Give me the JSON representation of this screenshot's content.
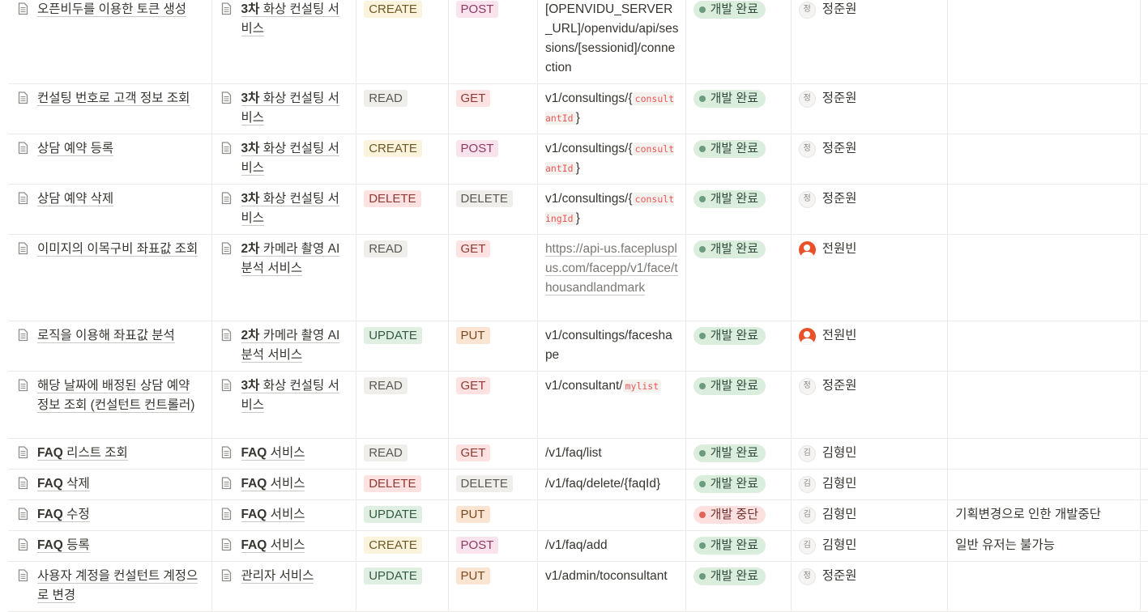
{
  "colors": {
    "crud": {
      "CREATE": {
        "bg": "#fbf3db",
        "fg": "#6b5a28"
      },
      "READ": {
        "bg": "#efeeeb",
        "fg": "#5a5854"
      },
      "DELETE": {
        "bg": "#fde2e1",
        "fg": "#8d3a35"
      },
      "UPDATE": {
        "bg": "#dff0e3",
        "fg": "#365a3f"
      }
    },
    "method": {
      "POST": {
        "bg": "#f9e4ee",
        "fg": "#8c3a63"
      },
      "GET": {
        "bg": "#fde2e1",
        "fg": "#8d3a35"
      },
      "DELETE": {
        "bg": "#efeeeb",
        "fg": "#5a5854"
      },
      "PUT": {
        "bg": "#fbe4d2",
        "fg": "#7a4a22"
      }
    },
    "status": {
      "done": {
        "bg": "#dbeddd",
        "fg": "#2f4b35",
        "dot": "#6c9b7d"
      },
      "stopped": {
        "bg": "#fde1e0",
        "fg": "#6e2d2a",
        "dot": "#e16259"
      }
    }
  },
  "rows": [
    {
      "name": "오픈비두를 이용한 토큰 생성",
      "service": "3차 화상 컨설팅 서비스",
      "service_prefix": "3차",
      "service_rest": " 화상 컨설팅 서비스",
      "crud": "CREATE",
      "method": "POST",
      "url_parts": [
        {
          "t": "[OPENVIDU_SERVER_URL]/openvidu/api/sessions/[sessionid]/connection"
        }
      ],
      "status": "개발 완료",
      "status_kind": "done",
      "person": "정준원",
      "avatar": "정",
      "avatar_kind": "initial",
      "note": ""
    },
    {
      "name": "컨설팅 번호로 고객 정보 조회",
      "service": "3차 화상 컨설팅 서비스",
      "service_prefix": "3차",
      "service_rest": " 화상 컨설팅 서비스",
      "crud": "READ",
      "method": "GET",
      "url_parts": [
        {
          "t": "v1/consultings/{"
        },
        {
          "c": "consultantId"
        },
        {
          "t": "}"
        }
      ],
      "status": "개발 완료",
      "status_kind": "done",
      "person": "정준원",
      "avatar": "정",
      "avatar_kind": "initial",
      "note": ""
    },
    {
      "name": "상담 예약 등록",
      "service": "3차 화상 컨설팅 서비스",
      "service_prefix": "3차",
      "service_rest": " 화상 컨설팅 서비스",
      "crud": "CREATE",
      "method": "POST",
      "url_parts": [
        {
          "t": "v1/consultings/{"
        },
        {
          "c": "consultantId"
        },
        {
          "t": "}"
        }
      ],
      "status": "개발 완료",
      "status_kind": "done",
      "person": "정준원",
      "avatar": "정",
      "avatar_kind": "initial",
      "note": ""
    },
    {
      "name": "상담 예약 삭제",
      "service": "3차 화상 컨설팅 서비스",
      "service_prefix": "3차",
      "service_rest": " 화상 컨설팅 서비스",
      "crud": "DELETE",
      "method": "DELETE",
      "url_parts": [
        {
          "t": "v1/consultings/{"
        },
        {
          "c": "consultingId"
        },
        {
          "t": "}"
        }
      ],
      "status": "개발 완료",
      "status_kind": "done",
      "person": "정준원",
      "avatar": "정",
      "avatar_kind": "initial",
      "note": ""
    },
    {
      "name": "이미지의  이목구비 좌표값 조회",
      "service": "2차 카메라 촬영 AI 분석 서비스",
      "service_prefix": "2차",
      "service_rest": " 카메라 촬영 AI 분석 서비스",
      "crud": "READ",
      "method": "GET",
      "url_parts": [
        {
          "l": "https://api-us.faceplusplus.com/facepp/v1/face/thousandlandmark"
        }
      ],
      "status": "개발 완료",
      "status_kind": "done",
      "person": "전원빈",
      "avatar": "",
      "avatar_kind": "photo",
      "note": ""
    },
    {
      "name": "로직을 이용해 좌표값 분석",
      "service": "2차 카메라 촬영 AI 분석 서비스",
      "service_prefix": "2차",
      "service_rest": " 카메라 촬영 AI 분석 서비스",
      "crud": "UPDATE",
      "method": "PUT",
      "url_parts": [
        {
          "t": "v1/consultings/faceshape"
        }
      ],
      "status": "개발 완료",
      "status_kind": "done",
      "person": "전원빈",
      "avatar": "",
      "avatar_kind": "photo",
      "note": ""
    },
    {
      "name": "해당 날짜에 배정된 상담 예약 정보 조회 (컨설턴트 컨트롤러)",
      "service": "3차 화상 컨설팅 서비스",
      "service_prefix": "3차",
      "service_rest": " 화상 컨설팅 서비스",
      "crud": "READ",
      "method": "GET",
      "url_parts": [
        {
          "t": "v1/consultant/"
        },
        {
          "c": "mylist"
        }
      ],
      "status": "개발 완료",
      "status_kind": "done",
      "person": "정준원",
      "avatar": "정",
      "avatar_kind": "initial",
      "note": ""
    },
    {
      "name": "FAQ 리스트 조회",
      "service": "FAQ 서비스",
      "service_prefix": "FAQ",
      "service_rest": " 서비스",
      "crud": "READ",
      "method": "GET",
      "url_parts": [
        {
          "t": "/v1/faq/list"
        }
      ],
      "status": "개발 완료",
      "status_kind": "done",
      "person": "김형민",
      "avatar": "김",
      "avatar_kind": "initial",
      "note": ""
    },
    {
      "name": "FAQ 삭제",
      "service": "FAQ 서비스",
      "service_prefix": "FAQ",
      "service_rest": " 서비스",
      "crud": "DELETE",
      "method": "DELETE",
      "url_parts": [
        {
          "t": "/v1/faq/delete/{faqId}"
        }
      ],
      "status": "개발 완료",
      "status_kind": "done",
      "person": "김형민",
      "avatar": "김",
      "avatar_kind": "initial",
      "note": ""
    },
    {
      "name": "FAQ 수정",
      "service": "FAQ 서비스",
      "service_prefix": "FAQ",
      "service_rest": " 서비스",
      "crud": "UPDATE",
      "method": "PUT",
      "url_parts": [],
      "status": "개발 중단",
      "status_kind": "stopped",
      "person": "김형민",
      "avatar": "김",
      "avatar_kind": "initial",
      "note": "기획변경으로 인한 개발중단"
    },
    {
      "name": "FAQ 등록",
      "service": "FAQ 서비스",
      "service_prefix": "FAQ",
      "service_rest": " 서비스",
      "crud": "CREATE",
      "method": "POST",
      "url_parts": [
        {
          "t": "/v1/faq/add"
        }
      ],
      "status": "개발 완료",
      "status_kind": "done",
      "person": "김형민",
      "avatar": "김",
      "avatar_kind": "initial",
      "note": "일반 유저는 불가능"
    },
    {
      "name": "사용자 계정을 컨설턴트 계정으로 변경",
      "service": "관리자 서비스",
      "service_prefix": "",
      "service_rest": "관리자 서비스",
      "crud": "UPDATE",
      "method": "PUT",
      "url_parts": [
        {
          "t": "v1/admin/toconsultant"
        }
      ],
      "status": "개발 완료",
      "status_kind": "done",
      "person": "정준원",
      "avatar": "정",
      "avatar_kind": "initial",
      "note": ""
    }
  ]
}
